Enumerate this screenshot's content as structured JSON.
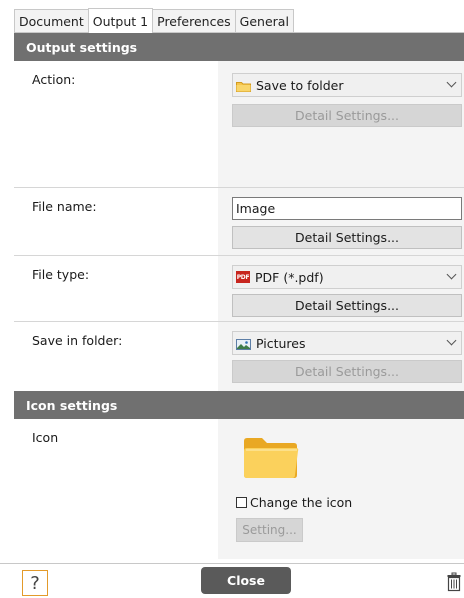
{
  "tabs": [
    {
      "label": "Document"
    },
    {
      "label": "Output 1"
    },
    {
      "label": "Preferences"
    },
    {
      "label": "General"
    }
  ],
  "output_settings": {
    "header": "Output settings",
    "action": {
      "label": "Action:",
      "value": "Save to folder",
      "detail_button": "Detail Settings..."
    },
    "file_name": {
      "label": "File name:",
      "value": "Image",
      "detail_button": "Detail Settings..."
    },
    "file_type": {
      "label": "File type:",
      "value": "PDF (*.pdf)",
      "icon_text": "PDF",
      "detail_button": "Detail Settings..."
    },
    "save_in_folder": {
      "label": "Save in folder:",
      "value": "Pictures",
      "detail_button": "Detail Settings..."
    }
  },
  "icon_settings": {
    "header": "Icon settings",
    "label": "Icon",
    "change_icon_label": "Change the icon",
    "setting_button": "Setting..."
  },
  "footer": {
    "help": "?",
    "close": "Close"
  },
  "colors": {
    "section_header": "#707070",
    "control_panel": "#f4f4f4",
    "close_button": "#5a5a5a",
    "help_border": "#e39a2a",
    "folder": "#f5c542"
  },
  "icons": [
    "folder-icon",
    "pdf-icon",
    "pictures-icon",
    "large-folder-icon",
    "help-icon",
    "trash-icon"
  ]
}
